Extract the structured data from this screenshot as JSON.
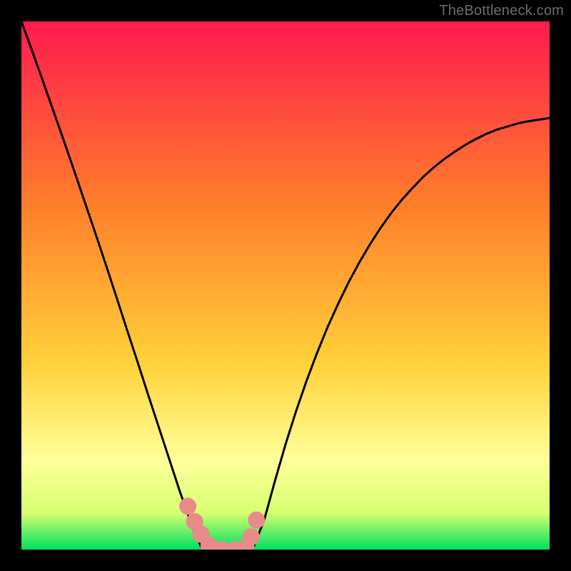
{
  "watermark": "TheBottleneck.com",
  "colors": {
    "frame": "#000000",
    "curve": "#000000",
    "marker_fill": "#e98a8a",
    "marker_stroke": "#cf6f6f",
    "grad_top": "#ff1a4f",
    "grad_mid1": "#ff7f2a",
    "grad_mid2": "#ffd23a",
    "grad_band_top": "#ffff9a",
    "grad_band_bot": "#d8ff70",
    "grad_bottom": "#00e060"
  },
  "chart_data": {
    "type": "line",
    "title": "",
    "xlabel": "",
    "ylabel": "",
    "xlim": [
      0,
      100
    ],
    "ylim": [
      0,
      100
    ],
    "x": [
      0,
      2,
      4,
      6,
      8,
      10,
      12,
      14,
      16,
      18,
      20,
      22,
      24,
      26,
      28,
      30,
      32,
      34,
      36,
      38,
      40,
      42,
      44,
      46,
      48,
      50,
      52,
      54,
      56,
      58,
      60,
      62,
      64,
      66,
      68,
      70,
      72,
      74,
      76,
      78,
      80,
      82,
      84,
      86,
      88,
      90,
      92,
      94,
      96,
      98,
      100
    ],
    "values": [
      100,
      94.5,
      88.9,
      83.2,
      77.5,
      71.7,
      65.8,
      59.9,
      53.9,
      47.8,
      41.6,
      35.5,
      29.3,
      23.2,
      17.1,
      11.0,
      5.3,
      0.6,
      0.0,
      0.0,
      0.0,
      0.0,
      0.6,
      5.7,
      13.0,
      19.9,
      26.2,
      32.0,
      37.3,
      42.2,
      46.6,
      50.7,
      54.4,
      57.8,
      60.9,
      63.7,
      66.2,
      68.4,
      70.5,
      72.3,
      73.9,
      75.3,
      76.6,
      77.7,
      78.7,
      79.5,
      80.1,
      80.7,
      81.1,
      81.4,
      81.7
    ],
    "markers": {
      "x": [
        31.5,
        32.8,
        34.0,
        35.5,
        38.0,
        40.5,
        42.5,
        43.5,
        44.5
      ],
      "y": [
        8.2,
        5.3,
        2.9,
        0.8,
        0.0,
        0.0,
        0.4,
        2.4,
        5.6
      ]
    }
  }
}
